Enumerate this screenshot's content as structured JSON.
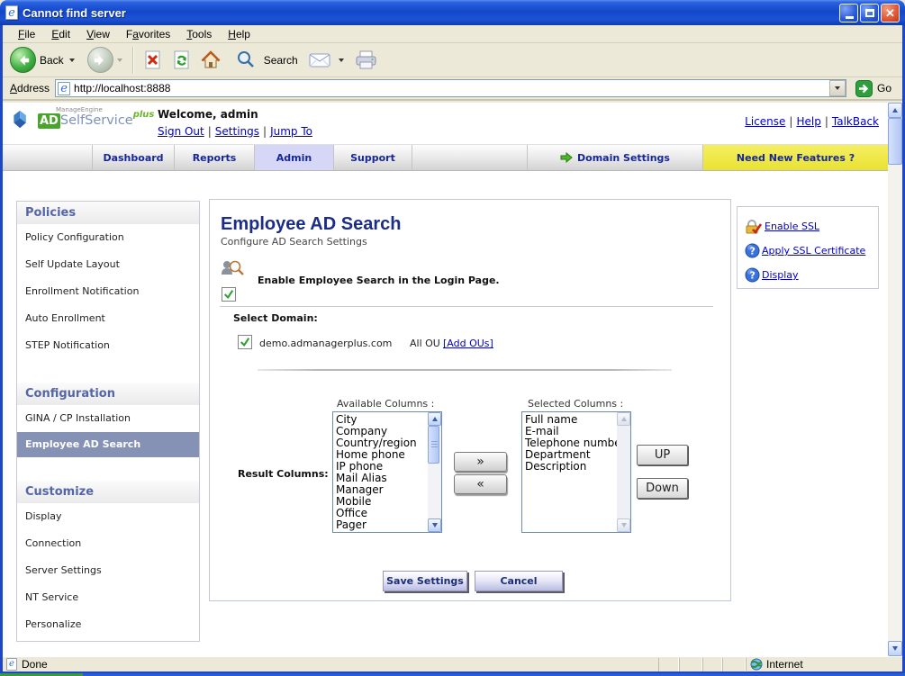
{
  "window": {
    "title": "Cannot find server",
    "menu": [
      {
        "label": "File",
        "accel": 0
      },
      {
        "label": "Edit",
        "accel": 0
      },
      {
        "label": "View",
        "accel": 0
      },
      {
        "label": "Favorites",
        "accel": 1
      },
      {
        "label": "Tools",
        "accel": 0
      },
      {
        "label": "Help",
        "accel": 0
      }
    ],
    "toolbar": {
      "back_label": "Back",
      "search_label": "Search"
    },
    "address": {
      "label": "Address",
      "url": "http://localhost:8888",
      "go_label": "Go"
    }
  },
  "header": {
    "logo": {
      "brand": "ManageEngine",
      "ad": "AD",
      "name": "SelfService",
      "plus": "plus"
    },
    "welcome": "Welcome, admin",
    "links": [
      "Sign Out",
      "Settings",
      "Jump To"
    ],
    "right_links": [
      "License",
      "Help",
      "TalkBack"
    ],
    "separator": "|"
  },
  "tabs": {
    "items": [
      "Dashboard",
      "Reports",
      "Admin",
      "Support"
    ],
    "active": "Admin",
    "domain_settings": "Domain Settings",
    "need_features": "Need New Features ?"
  },
  "sidebar": {
    "sections": [
      {
        "title": "Policies",
        "items": [
          "Policy Configuration",
          "Self Update Layout",
          "Enrollment Notification",
          "Auto Enrollment",
          "STEP Notification"
        ],
        "selected": ""
      },
      {
        "title": "Configuration",
        "items": [
          "GINA / CP Installation",
          "Employee AD Search"
        ],
        "selected": "Employee AD Search"
      },
      {
        "title": "Customize",
        "items": [
          "Display",
          "Connection",
          "Server Settings",
          "NT Service",
          "Personalize"
        ],
        "selected": ""
      }
    ]
  },
  "main": {
    "title": "Employee AD Search",
    "subtitle": "Configure AD Search Settings",
    "enable_label": "Enable Employee Search in the Login Page.",
    "enable_checked": true,
    "select_domain_label": "Select Domain:",
    "domain": {
      "name": "demo.admanagerplus.com",
      "ou_label": "All OU",
      "add_ous": "[Add OUs]",
      "checked": true
    },
    "result_columns_label": "Result Columns:",
    "available_label": "Available Columns :",
    "available": [
      "City",
      "Company",
      "Country/region",
      "Home phone",
      "IP phone",
      "Mail Alias",
      "Manager",
      "Mobile",
      "Office",
      "Pager"
    ],
    "selected_label": "Selected Columns :",
    "selected": [
      "Full name",
      "E-mail",
      "Telephone number",
      "Department",
      "Description"
    ],
    "move_right": "»",
    "move_left": "«",
    "up_label": "UP",
    "down_label": "Down",
    "save_label": "Save Settings",
    "cancel_label": "Cancel"
  },
  "quick_links": [
    {
      "icon": "lock",
      "label": "Enable SSL"
    },
    {
      "icon": "help",
      "label": "Apply SSL Certificate"
    },
    {
      "icon": "help",
      "label": "Display"
    }
  ],
  "statusbar": {
    "status": "Done",
    "zone": "Internet"
  },
  "colors": {
    "accent_green": "#4aa32d",
    "tab_text": "#16269c",
    "selected_item_bg": "#8591b5",
    "yellow_tab": "#efe94a",
    "title_blue": "#1347c8"
  }
}
